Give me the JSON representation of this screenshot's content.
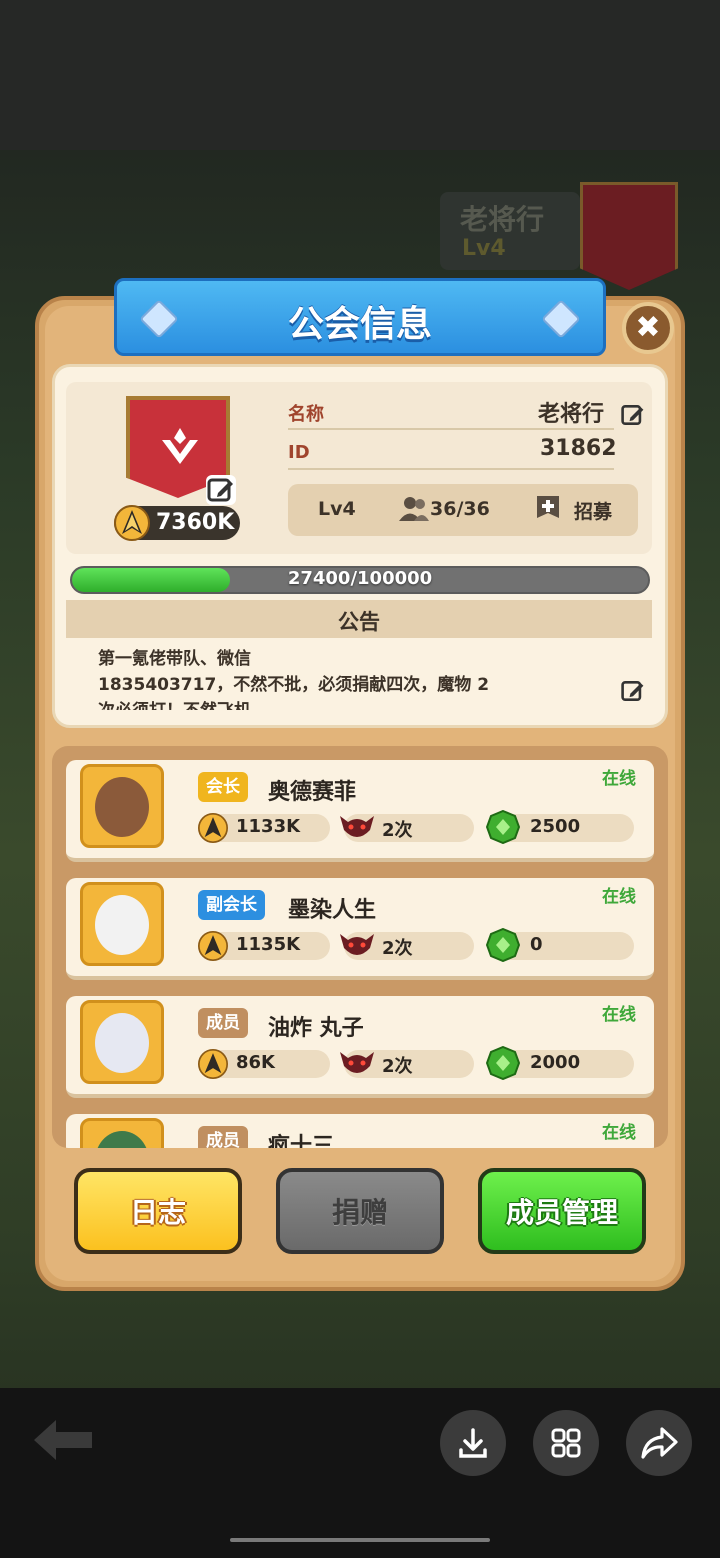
{
  "background": {
    "name": "老将行",
    "level": "Lv4"
  },
  "dialog": {
    "title": "公会信息"
  },
  "guild": {
    "power": "7360K",
    "name_label": "名称",
    "name": "老将行",
    "id_label": "ID",
    "id": "31862",
    "level": "Lv4",
    "members": "36/36",
    "recruit_label": "招募",
    "exp": "27400/100000",
    "exp_ratio": 0.274
  },
  "notice": {
    "title": "公告",
    "text": "第一氪佬带队、微信\n1835403717，不然不批，必须捐献四次，魔物 2\n次必须打！不然飞机"
  },
  "members": [
    {
      "role": "会长",
      "name": "奥德赛菲",
      "power": "1133K",
      "times": "2次",
      "donation": "2500",
      "status": "在线",
      "role_color": "#f0b51e"
    },
    {
      "role": "副会长",
      "name": "墨染人生",
      "power": "1135K",
      "times": "2次",
      "donation": "0",
      "status": "在线",
      "role_color": "#2d8fe0"
    },
    {
      "role": "成员",
      "name": "油炸 丸子",
      "power": "86K",
      "times": "2次",
      "donation": "2000",
      "status": "在线",
      "role_color": "#c08f60"
    },
    {
      "role": "成员",
      "name": "疯十三",
      "status": "在线",
      "role_color": "#c08f60"
    }
  ],
  "buttons": {
    "log": "日志",
    "donate": "捐赠",
    "manage": "成员管理"
  },
  "icons": [
    "close-icon",
    "edit-icon",
    "power-icon",
    "members-icon",
    "recruit-icon",
    "demon-icon",
    "gem-icon",
    "back-arrow-icon",
    "download-icon",
    "grid-icon",
    "share-icon"
  ]
}
